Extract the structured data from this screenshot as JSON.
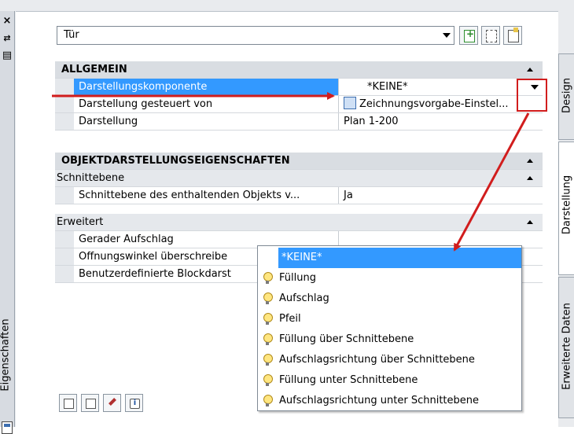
{
  "left_strip": {
    "close_glyph": "×",
    "autohide_glyph": "⇄",
    "properties_glyph": "▤",
    "title": "Eigenschaften"
  },
  "object_selector": {
    "value": "Tür"
  },
  "grid": {
    "allgemein": {
      "header": "ALLGEMEIN",
      "rows": [
        {
          "label": "Darstellungskomponente",
          "value": "*KEINE*"
        },
        {
          "label": "Darstellung gesteuert von",
          "value": "Zeichnungsvorgabe-Einstel..."
        },
        {
          "label": "Darstellung",
          "value": "Plan 1-200"
        }
      ]
    },
    "objekt": {
      "header": "OBJEKTDARSTELLUNGSEIGENSCHAFTEN",
      "schnitt_header": "Schnittebene",
      "schnitt_rows": [
        {
          "label": "Schnittebene des enthaltenden Objekts v...",
          "value": "Ja"
        }
      ],
      "erweitert_header": "Erweitert",
      "erweitert_rows": [
        {
          "label": "Gerader Aufschlag",
          "value": ""
        },
        {
          "label": "Öffnungswinkel überschreibe",
          "value": ""
        },
        {
          "label": "Benutzerdefinierte Blockdarst",
          "value": ""
        }
      ]
    }
  },
  "dropdown": {
    "options": [
      "*KEINE*",
      "Füllung",
      "Aufschlag",
      "Pfeil",
      "Füllung über Schnittebene",
      "Aufschlagsrichtung über Schnittebene",
      "Füllung unter Schnittebene",
      "Aufschlagsrichtung unter Schnittebene"
    ],
    "selected_index": 0
  },
  "tabs": {
    "design": "Design",
    "darstellung": "Darstellung",
    "erweiterte_daten": "Erweiterte Daten",
    "active": "darstellung"
  },
  "bottom_buttons": {
    "info_glyph": "i"
  },
  "colors": {
    "selection": "#3399ff",
    "annotation": "#d11d1d",
    "category_bg": "#d9dde2"
  },
  "icons": [
    "close-icon",
    "autohide-icon",
    "properties-icon",
    "add-selection-icon",
    "quick-select-icon",
    "select-objects-icon",
    "lightbulb-icon",
    "info-icon",
    "paintbrush-icon"
  ]
}
